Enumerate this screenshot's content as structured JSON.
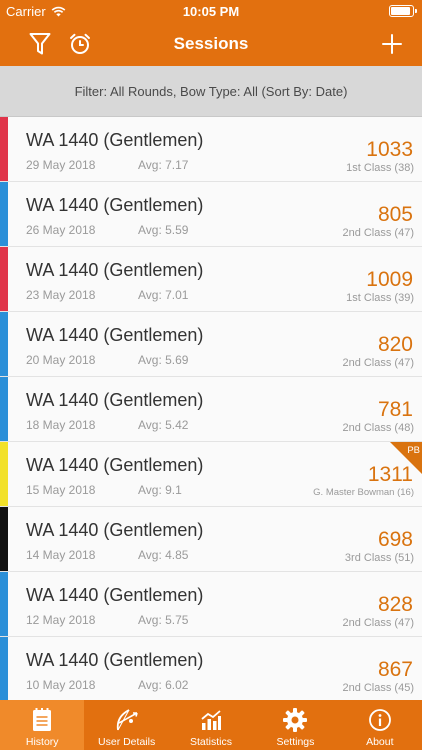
{
  "status_bar": {
    "carrier": "Carrier",
    "time": "10:05 PM",
    "battery_level": 0.95
  },
  "nav": {
    "title": "Sessions",
    "left_icons": [
      "filter-icon",
      "alarm-clock-icon"
    ],
    "right_icon": "plus-icon"
  },
  "filter": {
    "text": "Filter: All Rounds, Bow Type: All (Sort By: Date)"
  },
  "colors": {
    "brand_orange": "#e2700f",
    "score_orange": "#d9730f",
    "active_tab": "#f08a2a"
  },
  "sessions": [
    {
      "round": "WA 1440 (Gentlemen)",
      "date": "29 May 2018",
      "avg": "Avg: 7.17",
      "score": "1033",
      "classification": "1st Class (38)",
      "stripe": "#e0344a",
      "pb": false
    },
    {
      "round": "WA 1440 (Gentlemen)",
      "date": "26 May 2018",
      "avg": "Avg: 5.59",
      "score": "805",
      "classification": "2nd Class (47)",
      "stripe": "#2b8fd8",
      "pb": false
    },
    {
      "round": "WA 1440 (Gentlemen)",
      "date": "23 May 2018",
      "avg": "Avg: 7.01",
      "score": "1009",
      "classification": "1st Class (39)",
      "stripe": "#e0344a",
      "pb": false
    },
    {
      "round": "WA 1440 (Gentlemen)",
      "date": "20 May 2018",
      "avg": "Avg: 5.69",
      "score": "820",
      "classification": "2nd Class (47)",
      "stripe": "#2b8fd8",
      "pb": false
    },
    {
      "round": "WA 1440 (Gentlemen)",
      "date": "18 May 2018",
      "avg": "Avg: 5.42",
      "score": "781",
      "classification": "2nd Class (48)",
      "stripe": "#2b8fd8",
      "pb": false
    },
    {
      "round": "WA 1440 (Gentlemen)",
      "date": "15 May 2018",
      "avg": "Avg: 9.1",
      "score": "1311",
      "classification": "G. Master Bowman (16)",
      "stripe": "#f2e12a",
      "pb": true,
      "pb_label": "PB"
    },
    {
      "round": "WA 1440 (Gentlemen)",
      "date": "14 May 2018",
      "avg": "Avg: 4.85",
      "score": "698",
      "classification": "3rd Class (51)",
      "stripe": "#111111",
      "pb": false
    },
    {
      "round": "WA 1440 (Gentlemen)",
      "date": "12 May 2018",
      "avg": "Avg: 5.75",
      "score": "828",
      "classification": "2nd Class (47)",
      "stripe": "#2b8fd8",
      "pb": false
    },
    {
      "round": "WA 1440 (Gentlemen)",
      "date": "10 May 2018",
      "avg": "Avg: 6.02",
      "score": "867",
      "classification": "2nd Class (45)",
      "stripe": "#2b8fd8",
      "pb": false
    }
  ],
  "tabs": [
    {
      "label": "History",
      "icon": "history-icon",
      "active": true
    },
    {
      "label": "User Details",
      "icon": "archer-icon",
      "active": false
    },
    {
      "label": "Statistics",
      "icon": "statistics-icon",
      "active": false
    },
    {
      "label": "Settings",
      "icon": "gear-icon",
      "active": false
    },
    {
      "label": "About",
      "icon": "info-icon",
      "active": false
    }
  ]
}
